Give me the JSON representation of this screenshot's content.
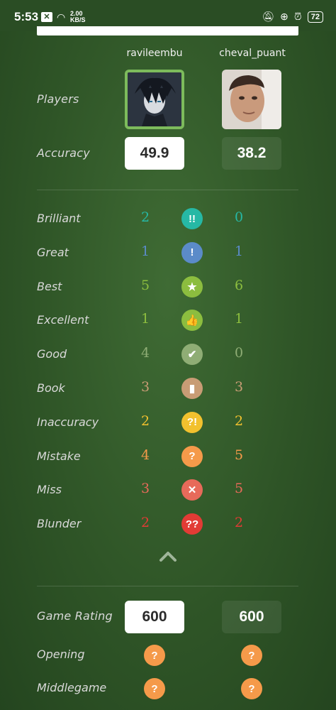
{
  "status_bar": {
    "time": "5:53",
    "speed_value": "2.00",
    "speed_unit": "KB/S",
    "battery": "72"
  },
  "players": {
    "label": "Players",
    "white": {
      "name": "ravileembu",
      "avatar_border": "#7dbb5c"
    },
    "black": {
      "name": "cheval_puant"
    }
  },
  "accuracy": {
    "label": "Accuracy",
    "white": "49.9",
    "black": "38.2"
  },
  "classifications": [
    {
      "label": "Brilliant",
      "white": "2",
      "black": "0",
      "symbol": "!!",
      "color": "#26b8a5",
      "icon": "brilliant-icon"
    },
    {
      "label": "Great",
      "white": "1",
      "black": "1",
      "symbol": "!",
      "color": "#5b8bc9",
      "icon": "great-icon"
    },
    {
      "label": "Best",
      "white": "5",
      "black": "6",
      "symbol": "★",
      "color": "#8cbd3f",
      "icon": "best-star-icon"
    },
    {
      "label": "Excellent",
      "white": "1",
      "black": "1",
      "symbol": "👍",
      "color": "#8cbd3f",
      "icon": "excellent-thumb-icon"
    },
    {
      "label": "Good",
      "white": "4",
      "black": "0",
      "symbol": "✔",
      "color": "#8fad75",
      "icon": "good-check-icon"
    },
    {
      "label": "Book",
      "white": "3",
      "black": "3",
      "symbol": "▮",
      "color": "#c89c75",
      "icon": "book-icon"
    },
    {
      "label": "Inaccuracy",
      "white": "2",
      "black": "2",
      "symbol": "?!",
      "color": "#f2c12e",
      "icon": "inaccuracy-icon"
    },
    {
      "label": "Mistake",
      "white": "4",
      "black": "5",
      "symbol": "?",
      "color": "#f59a4a",
      "icon": "mistake-icon"
    },
    {
      "label": "Miss",
      "white": "3",
      "black": "5",
      "symbol": "✕",
      "color": "#e76a5a",
      "icon": "miss-icon"
    },
    {
      "label": "Blunder",
      "white": "2",
      "black": "2",
      "symbol": "??",
      "color": "#e23b35",
      "icon": "blunder-icon"
    }
  ],
  "count_colors": [
    "#26b8a5",
    "#5b8bc9",
    "#8cbd3f",
    "#8cbd3f",
    "#8fad75",
    "#c89c75",
    "#f2c12e",
    "#f59a4a",
    "#e76a5a",
    "#e23b35"
  ],
  "game_rating": {
    "label": "Game Rating",
    "white": "600",
    "black": "600"
  },
  "phases": [
    {
      "label": "Opening",
      "white": "?",
      "black": "?",
      "color": "#f59a4a"
    },
    {
      "label": "Middlegame",
      "white": "?",
      "black": "?",
      "color": "#f59a4a"
    }
  ]
}
